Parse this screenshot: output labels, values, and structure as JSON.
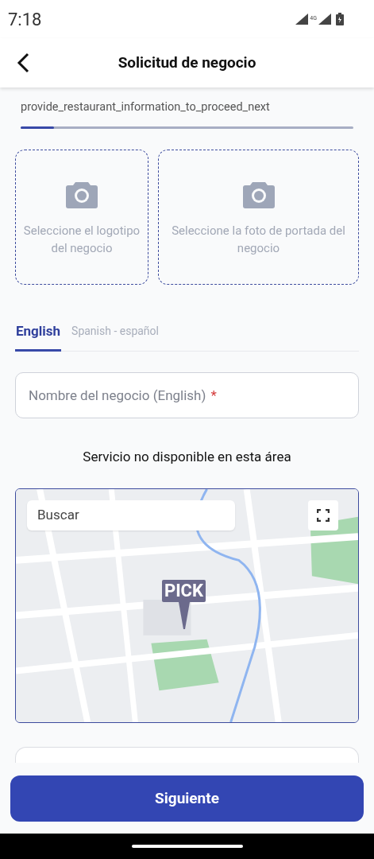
{
  "status_bar": {
    "time": "7:18",
    "network": "4G"
  },
  "app_bar": {
    "title": "Solicitud de negocio"
  },
  "instruction": "provide_restaurant_information_to_proceed_next",
  "progress": {
    "level": 0.1
  },
  "uploads": [
    {
      "label": "Seleccione el logotipo del negocio"
    },
    {
      "label": "Seleccione la foto de portada del negocio"
    }
  ],
  "tabs": [
    {
      "label": "English",
      "selected": true
    },
    {
      "label": "Spanish - español",
      "selected": false
    }
  ],
  "name_field": {
    "placeholder": "Nombre del negocio (English)",
    "required_mark": "*"
  },
  "service_message": "Servicio no disponible en esta área",
  "map": {
    "kind": "picture",
    "search_placeholder": "Buscar",
    "marker_label": "PICK"
  },
  "next_button": {
    "label": "Siguiente"
  }
}
